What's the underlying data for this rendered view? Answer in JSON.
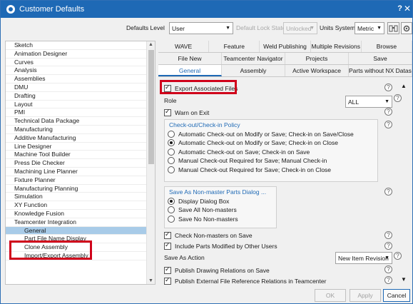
{
  "window": {
    "title": "Customer Defaults",
    "help": "?",
    "close": "✕"
  },
  "toolbar": {
    "defaults_level_label": "Defaults Level",
    "defaults_level_value": "User",
    "lock_state_label": "Default Lock State",
    "lock_state_value": "Unlocked",
    "units_system_label": "Units System",
    "units_system_value": "Metric",
    "binoculars_icon": "binoculars-icon",
    "gear_icon": "gear-icon"
  },
  "tree": {
    "items": [
      "Sketch",
      "Animation Designer",
      "Curves",
      "Analysis",
      "Assemblies",
      "DMU",
      "Drafting",
      "Layout",
      "PMI",
      "Technical Data Package",
      "Manufacturing",
      "Additive Manufacturing",
      "Line Designer",
      "Machine Tool Builder",
      "Press Die Checker",
      "Machining Line Planner",
      "Fixture Planner",
      "Manufacturing Planning",
      "Simulation",
      "XY Function",
      "Knowledge Fusion",
      "Teamcenter Integration"
    ],
    "children": [
      "General",
      "Part File Name Display",
      "Clone Assembly",
      "Import/Export Assembly"
    ],
    "selected": "General"
  },
  "tabs": {
    "row1": [
      "WAVE",
      "Feature",
      "Weld Publishing",
      "Multiple Revisions",
      "Browse"
    ],
    "row2": [
      "File New",
      "Teamcenter Navigator",
      "Projects",
      "Save"
    ],
    "row3": [
      "General",
      "Assembly",
      "Active Workspace",
      "Parts without NX Datasets"
    ],
    "active": "General"
  },
  "content": {
    "export_associated_files": "Export Associated Files",
    "role_label": "Role",
    "role_value": "ALL",
    "warn_on_exit": "Warn on Exit",
    "checkout_group_title": "Check-out/Check-in Policy",
    "checkout_options": [
      "Automatic Check-out on Modify or Save; Check-in on Save/Close",
      "Automatic Check-out on Modify or Save; Check-in on Close",
      "Automatic Check-out on Save; Check-in on Save",
      "Manual Check-out Required for Save; Manual Check-in",
      "Manual Check-out Required for Save; Check-in on Close"
    ],
    "checkout_selected_index": 1,
    "nonmaster_group_title": "Save As Non-master Parts Dialog ...",
    "nonmaster_options": [
      "Display Dialog Box",
      "Save All Non-masters",
      "Save No Non-masters"
    ],
    "nonmaster_selected_index": 0,
    "check_nonmasters": "Check Non-masters on Save",
    "include_parts_modified": "Include Parts Modified by Other Users",
    "save_as_action_label": "Save As Action",
    "save_as_action_value": "New Item Revision",
    "publish_drawing": "Publish Drawing Relations on Save",
    "publish_external": "Publish External File Reference Relations in Teamcenter"
  },
  "buttons": {
    "ok": "OK",
    "apply": "Apply",
    "cancel": "Cancel"
  },
  "colors": {
    "accent": "#1e69b5",
    "highlight": "#d0021b",
    "selected_row": "#a8cbe8"
  }
}
